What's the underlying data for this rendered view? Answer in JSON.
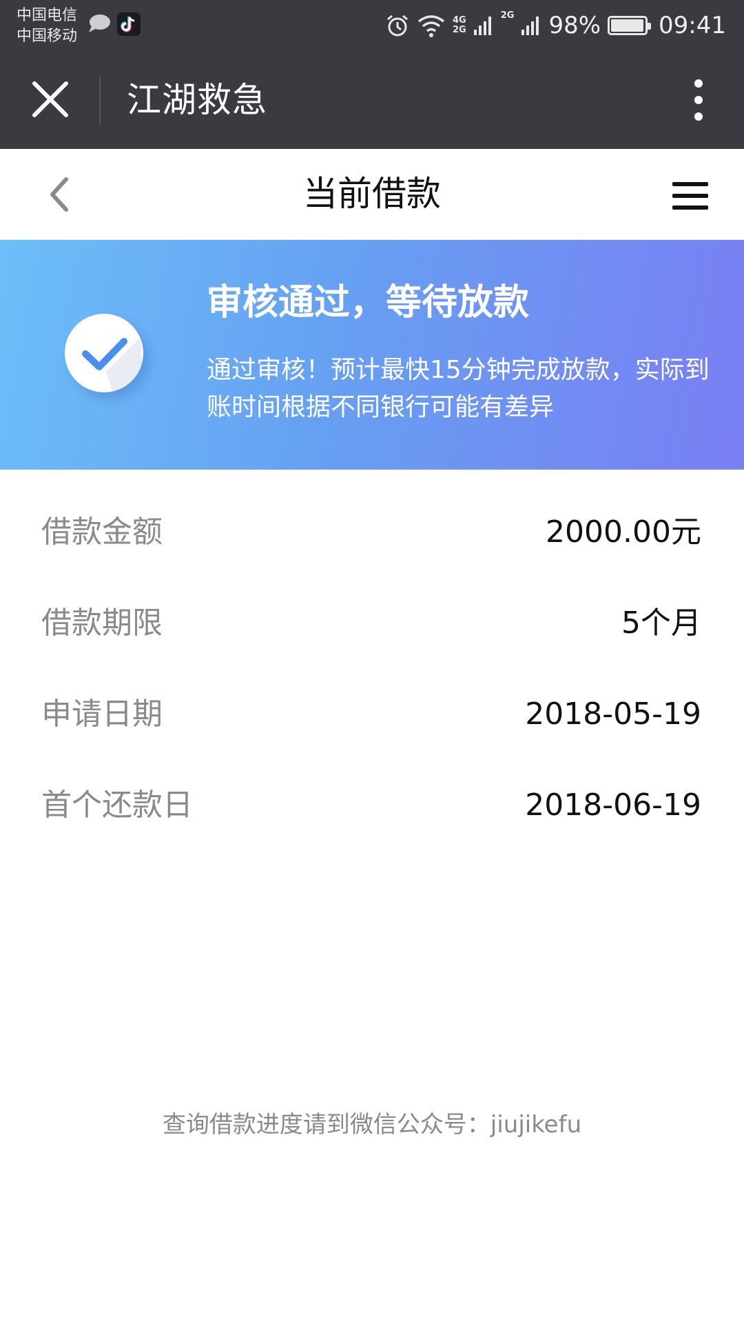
{
  "status_bar": {
    "carrier_1": "中国电信",
    "carrier_2": "中国移动",
    "net_4g": "4G",
    "net_2g_a": "2G",
    "net_2g_b": "2G",
    "battery_percent": "98%",
    "battery_level": 0.98,
    "time": "09:41",
    "icons": [
      "message-bubble-icon",
      "tiktok-icon",
      "alarm-icon",
      "wifi-icon",
      "signal-icon",
      "battery-icon"
    ]
  },
  "app_bar": {
    "title": "江湖救急",
    "icons": [
      "close-icon",
      "more-vertical-icon"
    ]
  },
  "page_header": {
    "title": "当前借款",
    "icons": [
      "chevron-left-icon",
      "menu-icon"
    ]
  },
  "banner": {
    "title": "审核通过，等待放款",
    "description": "通过审核！预计最快15分钟完成放款，实际到账时间根据不同银行可能有差异",
    "icon": "check-icon",
    "gradient_start": "#6cbef8",
    "gradient_end": "#7a7ef3",
    "check_color": "#4a8ef0"
  },
  "loan_info": [
    {
      "label": "借款金额",
      "value": "2000.00元"
    },
    {
      "label": "借款期限",
      "value": "5个月"
    },
    {
      "label": "申请日期",
      "value": "2018-05-19"
    },
    {
      "label": "首个还款日",
      "value": "2018-06-19"
    }
  ],
  "footer": {
    "note": "查询借款进度请到微信公众号：jiujikefu"
  }
}
